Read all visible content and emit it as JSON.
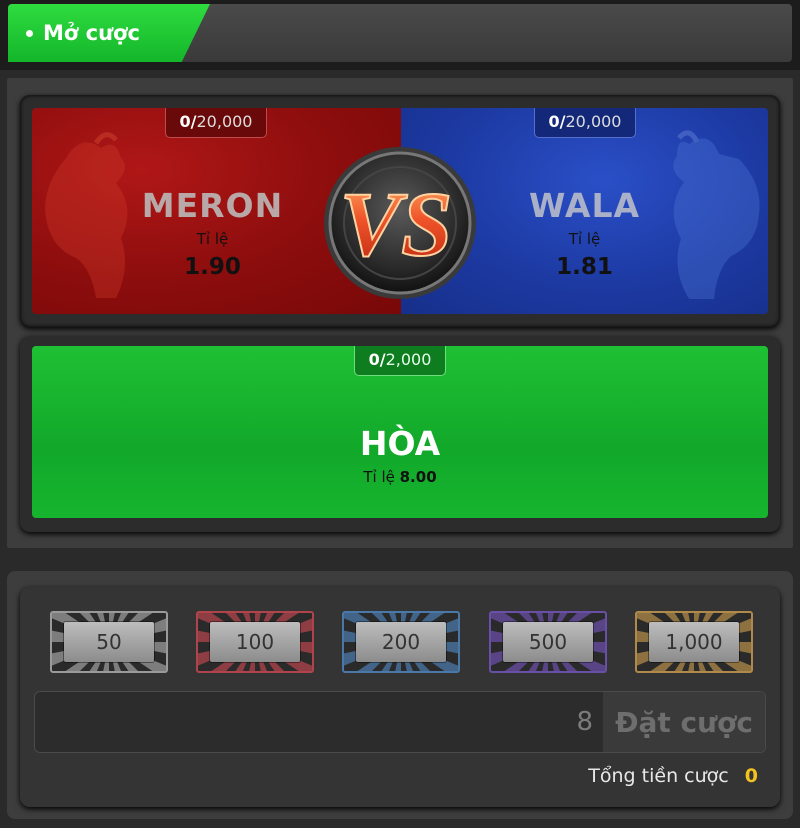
{
  "header": {
    "status_label": "Mở cược",
    "status_color": "#1fcb36"
  },
  "meron": {
    "name": "MERON",
    "limit_current": "0/",
    "limit_max": "20,000",
    "ratio_label": "Tỉ lệ",
    "ratio": "1.90",
    "color": "#8c0d0d"
  },
  "wala": {
    "name": "WALA",
    "limit_current": "0/",
    "limit_max": "20,000",
    "ratio_label": "Tỉ lệ",
    "ratio": "1.81",
    "color": "#1d3aa3"
  },
  "vs_badge": {
    "text": "VS"
  },
  "draw": {
    "name": "HÒA",
    "limit_current": "0/",
    "limit_max": "2,000",
    "ratio_label": "Tỉ lệ",
    "ratio": "8.00",
    "color": "#14b02c"
  },
  "chips": [
    {
      "label": "50",
      "color": "#9a9a9a"
    },
    {
      "label": "100",
      "color": "#b0444c"
    },
    {
      "label": "200",
      "color": "#4a78a8"
    },
    {
      "label": "500",
      "color": "#6a4fa6"
    },
    {
      "label": "1,000",
      "color": "#b08a4a"
    }
  ],
  "bet": {
    "amount": "8",
    "button_label": "Đặt cược"
  },
  "total": {
    "label": "Tổng tiền cược",
    "value": "0",
    "value_color": "#f2c21f"
  }
}
